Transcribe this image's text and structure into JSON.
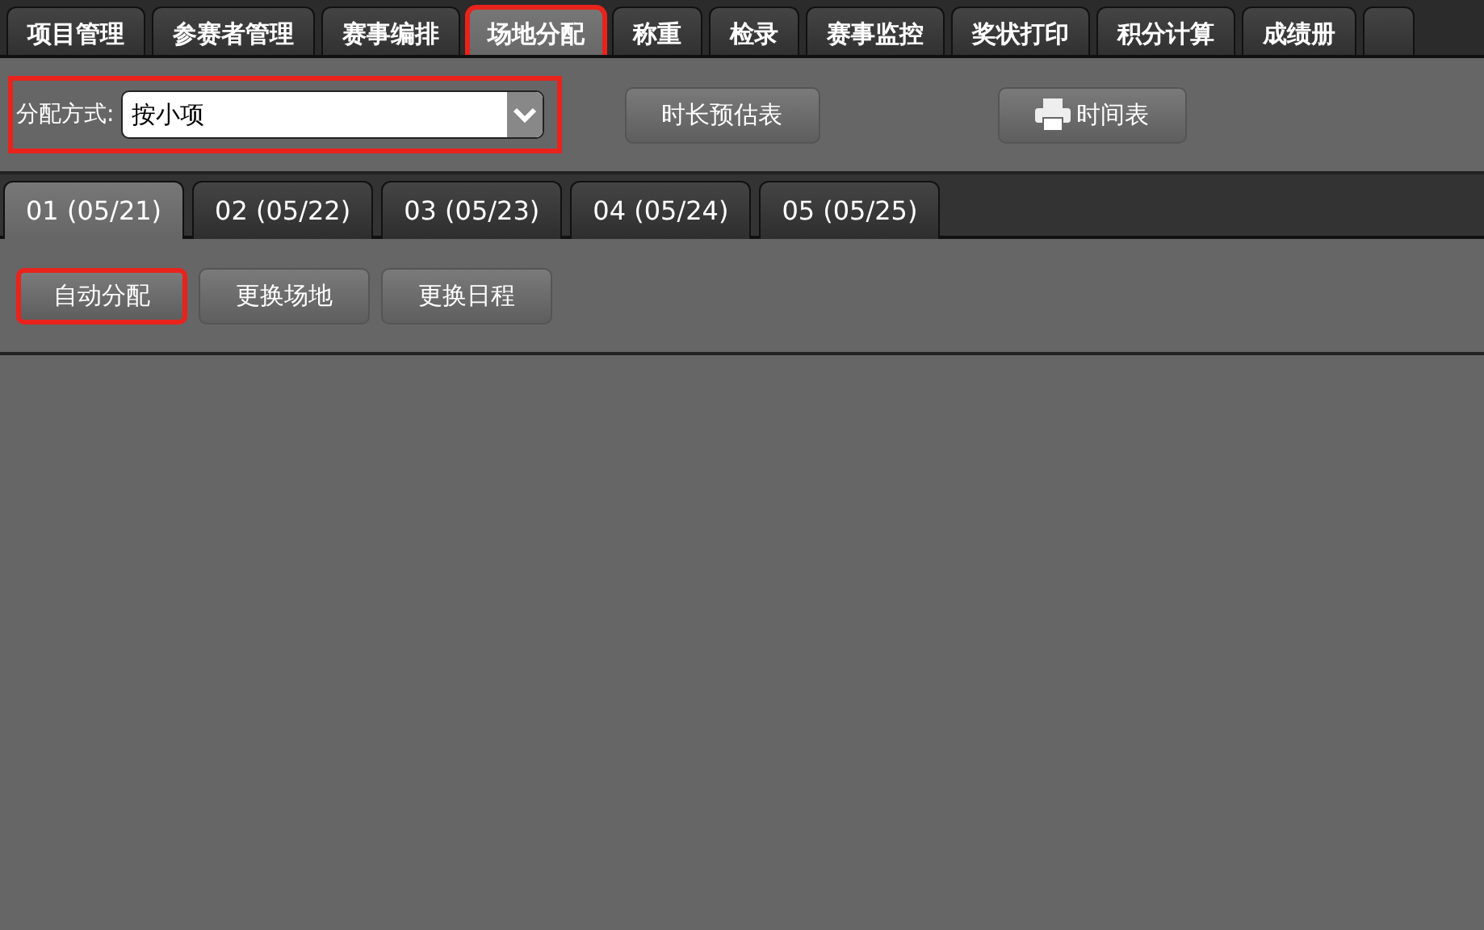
{
  "main_tabs": [
    {
      "label": "项目管理",
      "selected": false,
      "highlighted": false
    },
    {
      "label": "参赛者管理",
      "selected": false,
      "highlighted": false
    },
    {
      "label": "赛事编排",
      "selected": false,
      "highlighted": false
    },
    {
      "label": "场地分配",
      "selected": true,
      "highlighted": true
    },
    {
      "label": "称重",
      "selected": false,
      "highlighted": false
    },
    {
      "label": "检录",
      "selected": false,
      "highlighted": false
    },
    {
      "label": "赛事监控",
      "selected": false,
      "highlighted": false
    },
    {
      "label": "奖状打印",
      "selected": false,
      "highlighted": false
    },
    {
      "label": "积分计算",
      "selected": false,
      "highlighted": false
    },
    {
      "label": "成绩册",
      "selected": false,
      "highlighted": false
    }
  ],
  "assign_mode": {
    "label": "分配方式:",
    "value": "按小项",
    "highlighted": true
  },
  "toolbar_buttons": [
    {
      "label": "时长预估表",
      "kind": "plain"
    },
    {
      "label": "时间表",
      "kind": "print"
    }
  ],
  "day_tabs": [
    {
      "label": "01 (05/21)",
      "selected": true
    },
    {
      "label": "02 (05/22)",
      "selected": false
    },
    {
      "label": "03 (05/23)",
      "selected": false
    },
    {
      "label": "04 (05/24)",
      "selected": false
    },
    {
      "label": "05 (05/25)",
      "selected": false
    }
  ],
  "action_buttons": [
    {
      "label": "自动分配",
      "highlighted": true
    },
    {
      "label": "更换场地",
      "highlighted": false
    },
    {
      "label": "更换日程",
      "highlighted": false
    }
  ]
}
